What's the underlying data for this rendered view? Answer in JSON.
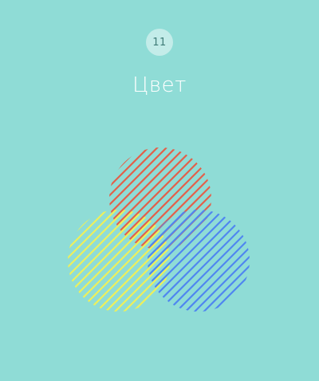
{
  "level": {
    "number": "11",
    "title": "Цвет"
  },
  "colors": {
    "background": "#8fdcd6",
    "badge": "#c3ece9",
    "title": "#ffffff"
  },
  "circles": [
    {
      "name": "red-hatched-circle",
      "color": "#e2604a"
    },
    {
      "name": "yellow-hatched-circle",
      "color": "#eef05a"
    },
    {
      "name": "blue-hatched-circle",
      "color": "#4f86f0"
    }
  ]
}
